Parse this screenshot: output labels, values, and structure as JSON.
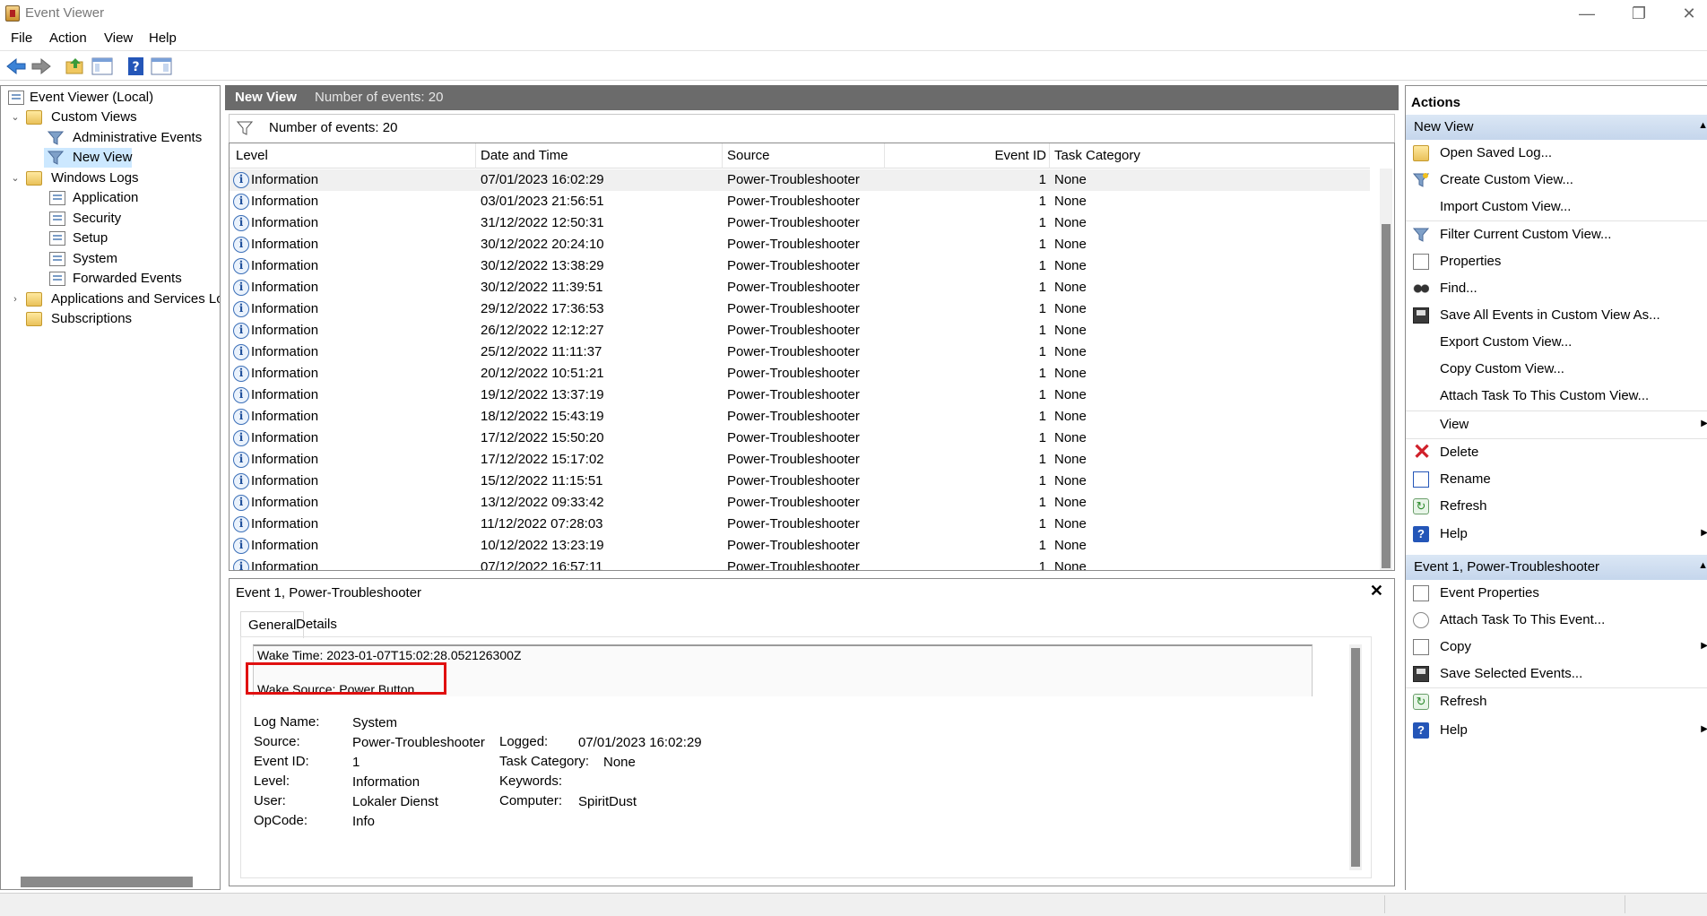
{
  "window": {
    "title": "Event Viewer"
  },
  "menu": [
    "File",
    "Action",
    "View",
    "Help"
  ],
  "tree": {
    "root": "Event Viewer (Local)",
    "custom_views": "Custom Views",
    "administrative_events": "Administrative Events",
    "new_view": "New View",
    "windows_logs": "Windows Logs",
    "application": "Application",
    "security": "Security",
    "setup": "Setup",
    "system": "System",
    "forwarded_events": "Forwarded Events",
    "apps_services": "Applications and Services Logs",
    "subscriptions": "Subscriptions"
  },
  "view_header": {
    "title": "New View",
    "count": "Number of events: 20"
  },
  "filter_bar": {
    "label": "Number of events: 20"
  },
  "grid": {
    "headers": {
      "level": "Level",
      "datetime": "Date and Time",
      "source": "Source",
      "event_id": "Event ID",
      "task_category": "Task Category"
    },
    "rows": [
      {
        "level": "Information",
        "datetime": "07/01/2023 16:02:29",
        "source": "Power-Troubleshooter",
        "event_id": "1",
        "task_category": "None"
      },
      {
        "level": "Information",
        "datetime": "03/01/2023 21:56:51",
        "source": "Power-Troubleshooter",
        "event_id": "1",
        "task_category": "None"
      },
      {
        "level": "Information",
        "datetime": "31/12/2022 12:50:31",
        "source": "Power-Troubleshooter",
        "event_id": "1",
        "task_category": "None"
      },
      {
        "level": "Information",
        "datetime": "30/12/2022 20:24:10",
        "source": "Power-Troubleshooter",
        "event_id": "1",
        "task_category": "None"
      },
      {
        "level": "Information",
        "datetime": "30/12/2022 13:38:29",
        "source": "Power-Troubleshooter",
        "event_id": "1",
        "task_category": "None"
      },
      {
        "level": "Information",
        "datetime": "30/12/2022 11:39:51",
        "source": "Power-Troubleshooter",
        "event_id": "1",
        "task_category": "None"
      },
      {
        "level": "Information",
        "datetime": "29/12/2022 17:36:53",
        "source": "Power-Troubleshooter",
        "event_id": "1",
        "task_category": "None"
      },
      {
        "level": "Information",
        "datetime": "26/12/2022 12:12:27",
        "source": "Power-Troubleshooter",
        "event_id": "1",
        "task_category": "None"
      },
      {
        "level": "Information",
        "datetime": "25/12/2022 11:11:37",
        "source": "Power-Troubleshooter",
        "event_id": "1",
        "task_category": "None"
      },
      {
        "level": "Information",
        "datetime": "20/12/2022 10:51:21",
        "source": "Power-Troubleshooter",
        "event_id": "1",
        "task_category": "None"
      },
      {
        "level": "Information",
        "datetime": "19/12/2022 13:37:19",
        "source": "Power-Troubleshooter",
        "event_id": "1",
        "task_category": "None"
      },
      {
        "level": "Information",
        "datetime": "18/12/2022 15:43:19",
        "source": "Power-Troubleshooter",
        "event_id": "1",
        "task_category": "None"
      },
      {
        "level": "Information",
        "datetime": "17/12/2022 15:50:20",
        "source": "Power-Troubleshooter",
        "event_id": "1",
        "task_category": "None"
      },
      {
        "level": "Information",
        "datetime": "17/12/2022 15:17:02",
        "source": "Power-Troubleshooter",
        "event_id": "1",
        "task_category": "None"
      },
      {
        "level": "Information",
        "datetime": "15/12/2022 11:15:51",
        "source": "Power-Troubleshooter",
        "event_id": "1",
        "task_category": "None"
      },
      {
        "level": "Information",
        "datetime": "13/12/2022 09:33:42",
        "source": "Power-Troubleshooter",
        "event_id": "1",
        "task_category": "None"
      },
      {
        "level": "Information",
        "datetime": "11/12/2022 07:28:03",
        "source": "Power-Troubleshooter",
        "event_id": "1",
        "task_category": "None"
      },
      {
        "level": "Information",
        "datetime": "10/12/2022 13:23:19",
        "source": "Power-Troubleshooter",
        "event_id": "1",
        "task_category": "None"
      },
      {
        "level": "Information",
        "datetime": "07/12/2022 16:57:11",
        "source": "Power-Troubleshooter",
        "event_id": "1",
        "task_category": "None"
      }
    ]
  },
  "details": {
    "title": "Event 1, Power-Troubleshooter",
    "close": "✕",
    "tabs": {
      "general": "General",
      "details": "Details"
    },
    "wake_time": "Wake Time: 2023-01-07T15:02:28.052126300Z",
    "wake_source": "Wake Source: Power Button",
    "labels": {
      "log_name": "Log Name:",
      "source": "Source:",
      "event_id": "Event ID:",
      "level": "Level:",
      "user": "User:",
      "opcode": "OpCode:",
      "logged": "Logged:",
      "task_category": "Task Category:",
      "keywords": "Keywords:",
      "computer": "Computer:"
    },
    "values": {
      "log_name": "System",
      "source": "Power-Troubleshooter",
      "event_id": "1",
      "level": "Information",
      "user": "Lokaler Dienst",
      "opcode": "Info",
      "logged": "07/01/2023 16:02:29",
      "task_category": "None",
      "keywords": "",
      "computer": "SpiritDust"
    }
  },
  "actions": {
    "header": "Actions",
    "section1": "New View",
    "items1": [
      "Open Saved Log...",
      "Create Custom View...",
      "Import Custom View...",
      "Filter Current Custom View...",
      "Properties",
      "Find...",
      "Save All Events in Custom View As...",
      "Export Custom View...",
      "Copy Custom View...",
      "Attach Task To This Custom View...",
      "View",
      "Delete",
      "Rename",
      "Refresh",
      "Help"
    ],
    "section2": "Event 1, Power-Troubleshooter",
    "items2": [
      "Event Properties",
      "Attach Task To This Event...",
      "Copy",
      "Save Selected Events...",
      "Refresh",
      "Help"
    ]
  },
  "colors": {
    "header_bg": "#6b6b6b",
    "section_bg": "#c5d6ec",
    "highlight": "#e01010",
    "selection": "#cce8ff"
  }
}
